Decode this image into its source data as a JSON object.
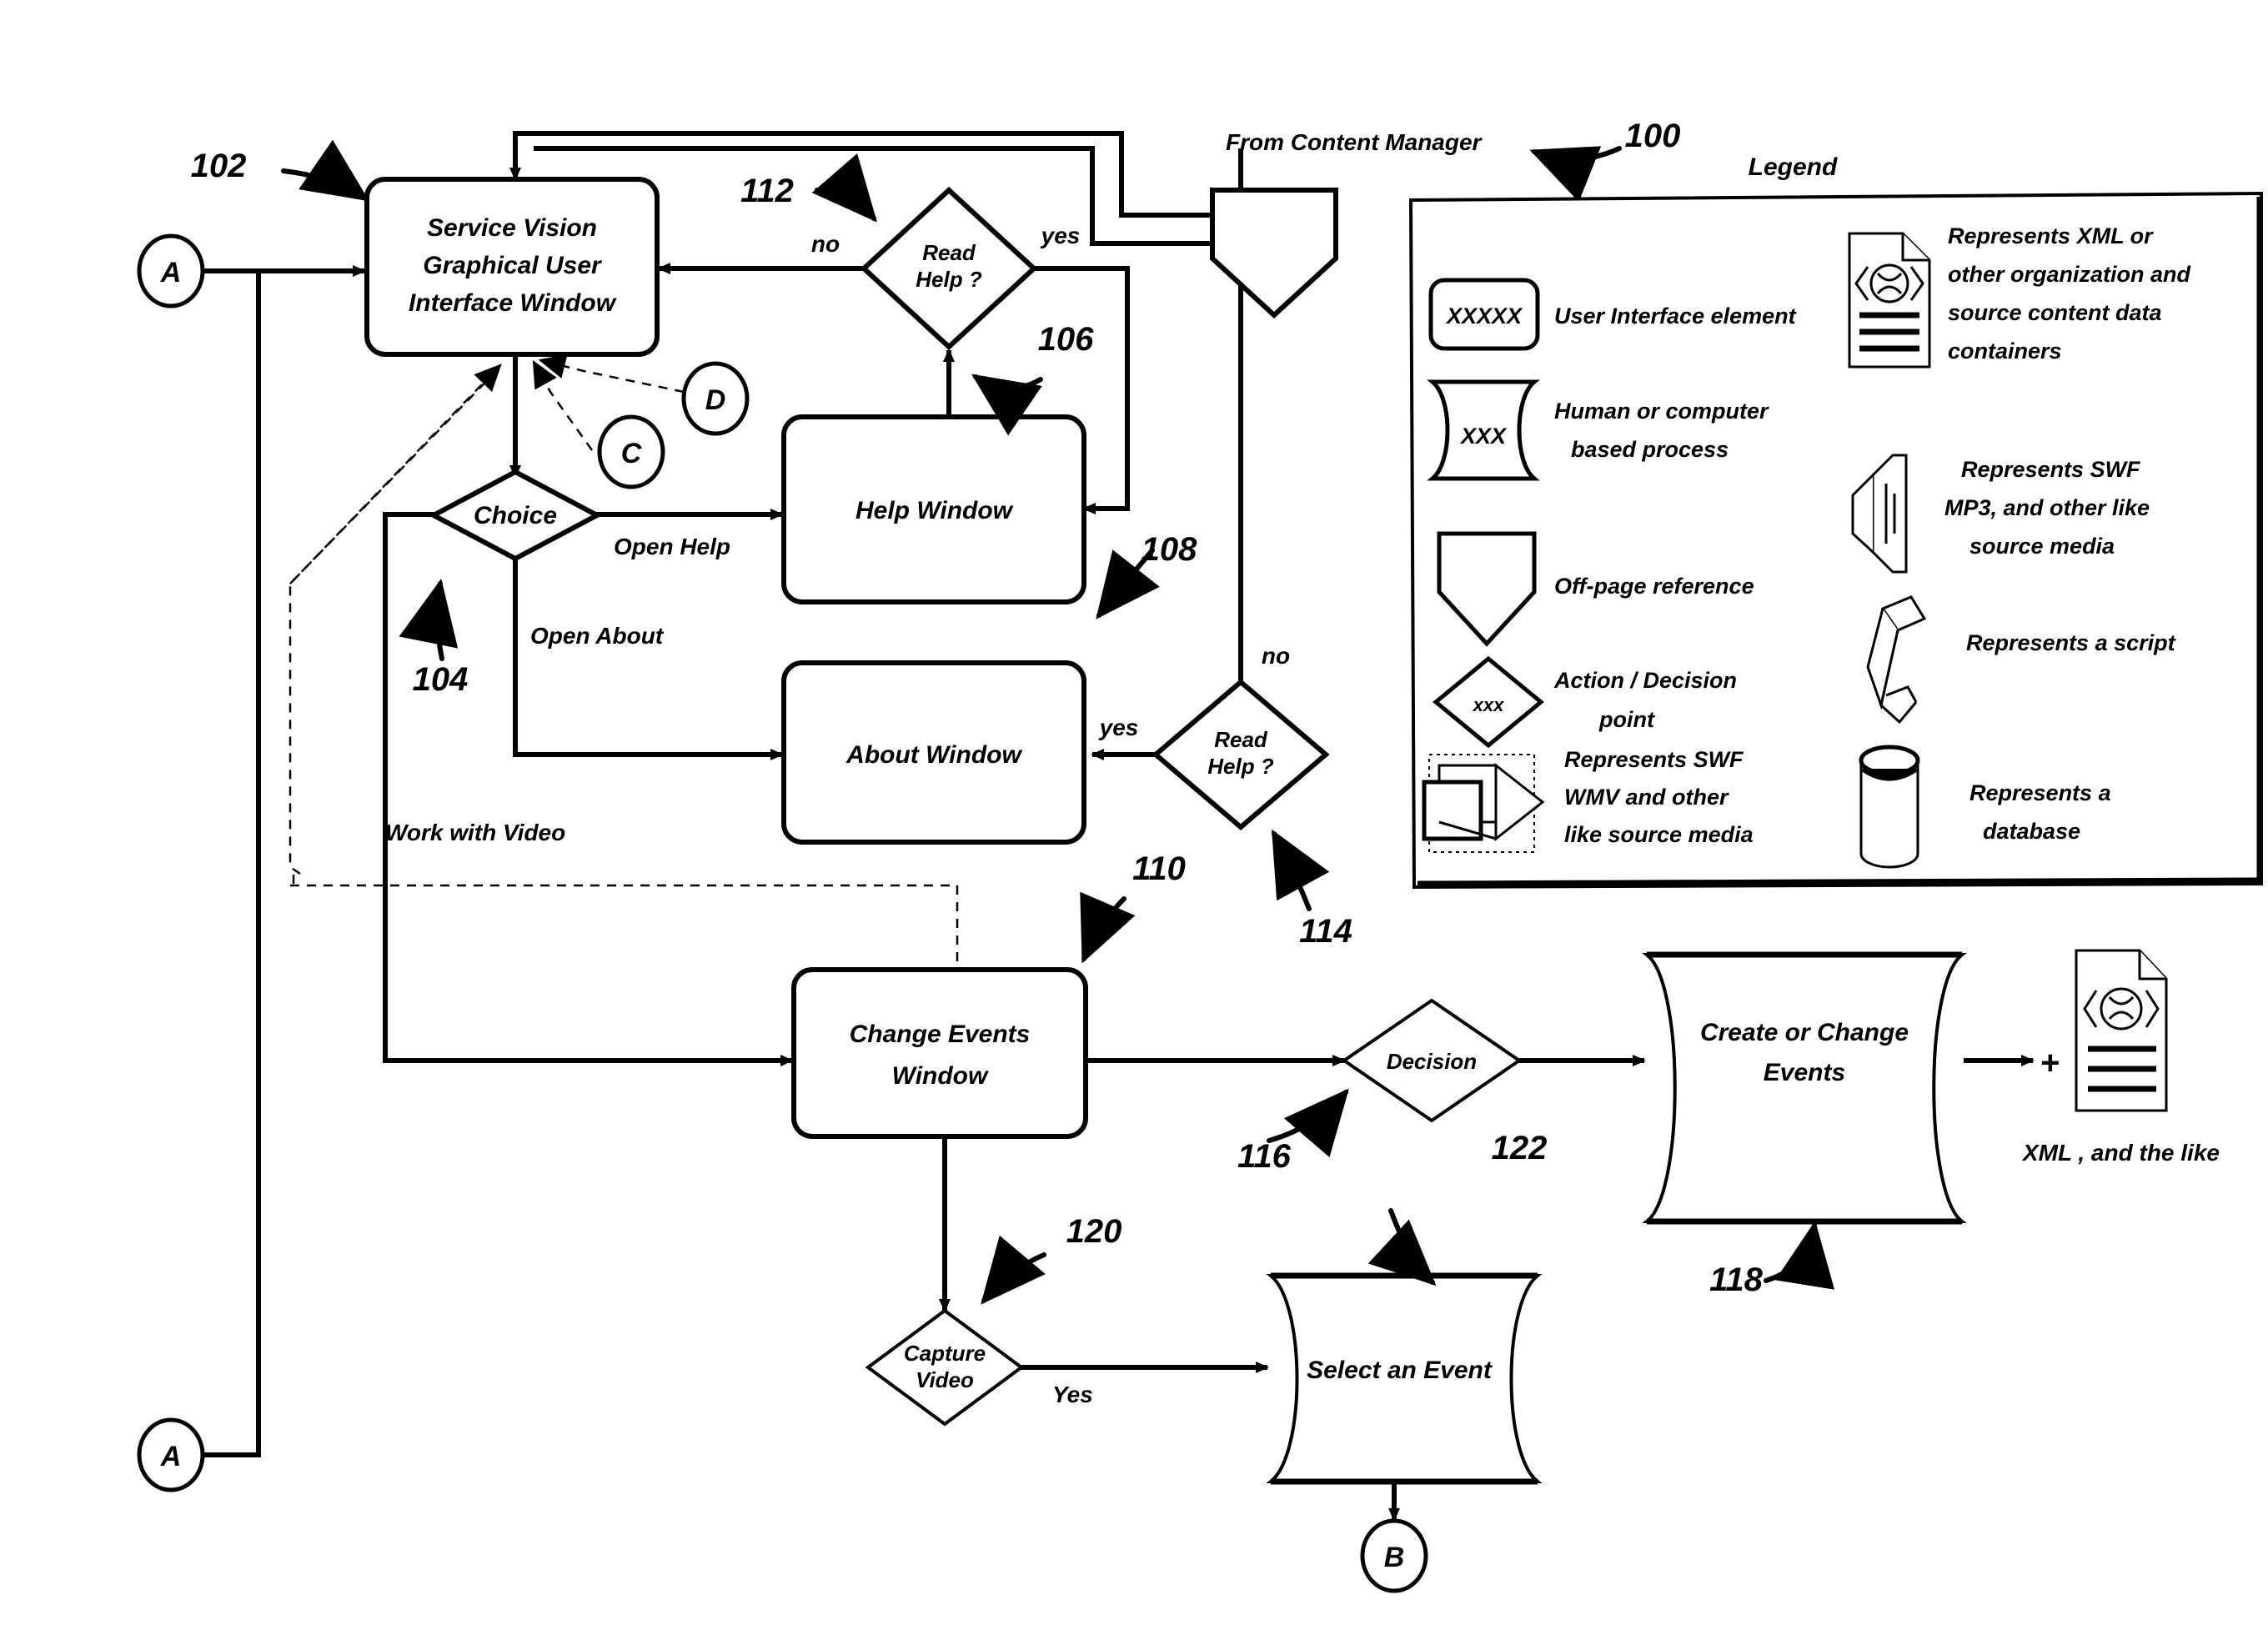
{
  "figure": {
    "reference_numeral": "100",
    "source_label": "From Content Manager",
    "legend_title": "Legend"
  },
  "nodes": {
    "gui_window": "Service Vision\nGraphical User\nInterface Window",
    "gui_window_line1": "Service Vision",
    "gui_window_line2": "Graphical User",
    "gui_window_line3": "Interface Window",
    "choice": "Choice",
    "help_window": "Help Window",
    "about_window": "About Window",
    "read_help_top_line1": "Read",
    "read_help_top_line2": "Help ?",
    "read_help_bottom_line1": "Read",
    "read_help_bottom_line2": "Help ?",
    "change_events_line1": "Change Events",
    "change_events_line2": "Window",
    "decision": "Decision",
    "create_or_change_line1": "Create or Change",
    "create_or_change_line2": "Events",
    "capture_video_line1": "Capture",
    "capture_video_line2": "Video",
    "select_an_event": "Select an Event",
    "xml_output": "XML , and the like",
    "plus_sign": "+"
  },
  "edge_labels": {
    "open_help": "Open Help",
    "open_about": "Open About",
    "work_with_video": "Work with Video",
    "read_help_top_no": "no",
    "read_help_top_yes": "yes",
    "read_help_bottom_no": "no",
    "read_help_bottom_yes": "yes",
    "capture_video_yes": "Yes"
  },
  "connectors": {
    "a_top": "A",
    "a_bottom": "A",
    "b": "B",
    "c": "C",
    "d": "D"
  },
  "reference_numerals": {
    "gui_window": "102",
    "choice": "104",
    "help_window": "106",
    "read_help_top": "112",
    "about_window": "108",
    "read_help_bottom": "114",
    "change_events": "110",
    "decision": "116",
    "create_or_change": "118",
    "capture_video": "120",
    "select_event": "122",
    "figure": "100"
  },
  "legend": {
    "title": "Legend",
    "items": [
      {
        "id": "ui-element",
        "sample": "XXXXX",
        "label": "User Interface element",
        "shape": "rounded-rect"
      },
      {
        "id": "process",
        "sample": "XXX",
        "label": "Human or computer\nbased process",
        "label_line1": "Human or computer",
        "label_line2": "based process",
        "shape": "document"
      },
      {
        "id": "off-page-reference",
        "sample": "",
        "label": "Off-page reference",
        "shape": "pentagon-down"
      },
      {
        "id": "action-decision",
        "sample": "xxx",
        "label": "Action / Decision\npoint",
        "label_line1": "Action / Decision",
        "label_line2": "point",
        "shape": "diamond"
      },
      {
        "id": "swf-wmv-media",
        "sample": "",
        "label": "Represents SWF\nWMV and other\nlike source media",
        "label_line1": "Represents SWF",
        "label_line2": "WMV and other",
        "label_line3": "like source media",
        "shape": "video-clip"
      },
      {
        "id": "xml-container",
        "sample": "",
        "label": "Represents XML or\nother organization and\nsource content data\ncontainers",
        "label_line1": "Represents XML or",
        "label_line2": "other organization and",
        "label_line3": "source content data",
        "label_line4": "containers",
        "shape": "xml-document"
      },
      {
        "id": "swf-mp3-media",
        "sample": "",
        "label": "Represents SWF\nMP3, and other like\nsource media",
        "label_line1": "Represents SWF",
        "label_line2": "MP3, and other like",
        "label_line3": "source media",
        "shape": "speaker"
      },
      {
        "id": "script",
        "sample": "",
        "label": "Represents a script",
        "shape": "scroll"
      },
      {
        "id": "database",
        "sample": "",
        "label": "Represents a\ndatabase",
        "label_line1": "Represents a",
        "label_line2": "database",
        "shape": "cylinder"
      }
    ]
  },
  "colors": {
    "ink": "#000000",
    "paper": "#ffffff"
  }
}
